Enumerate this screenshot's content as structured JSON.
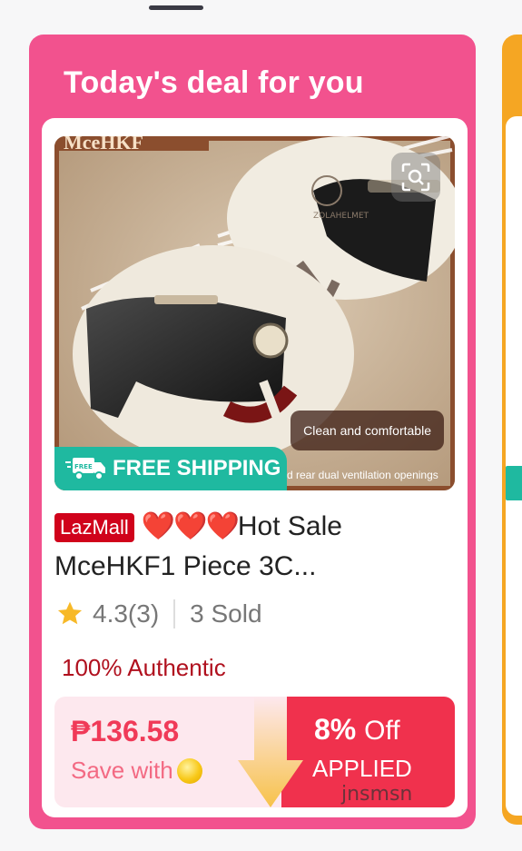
{
  "deal": {
    "title": "Today's deal for you"
  },
  "product": {
    "image_caption": "Clean and comfortable",
    "image_caption2": "d rear dual ventilation openings",
    "image_brand_text": "MceHKF",
    "shipping_badge": "FREE SHIPPING",
    "free_tag": "FREE",
    "store_badge": "LazMall",
    "hearts": "❤️❤️❤️",
    "name_line1": "Hot Sale",
    "name_line2": "MceHKF1 Piece 3C...",
    "rating": "4.3(3)",
    "sold": "3 Sold",
    "authentic": "100% Authentic"
  },
  "price": {
    "amount": "₱136.58",
    "save_with": "Save with",
    "promo_percent": "8%",
    "promo_off": "Off",
    "promo_applied": "APPLIED"
  },
  "watermark": "jnsmsn",
  "colors": {
    "card_pink": "#f2528e",
    "free_shipping_teal": "#1fb9a0",
    "price_red": "#f03a58",
    "lazmall_red": "#d0021b"
  },
  "icons": [
    "scan-icon",
    "truck-icon",
    "star-icon",
    "coin-icon",
    "arrow-down-icon"
  ]
}
